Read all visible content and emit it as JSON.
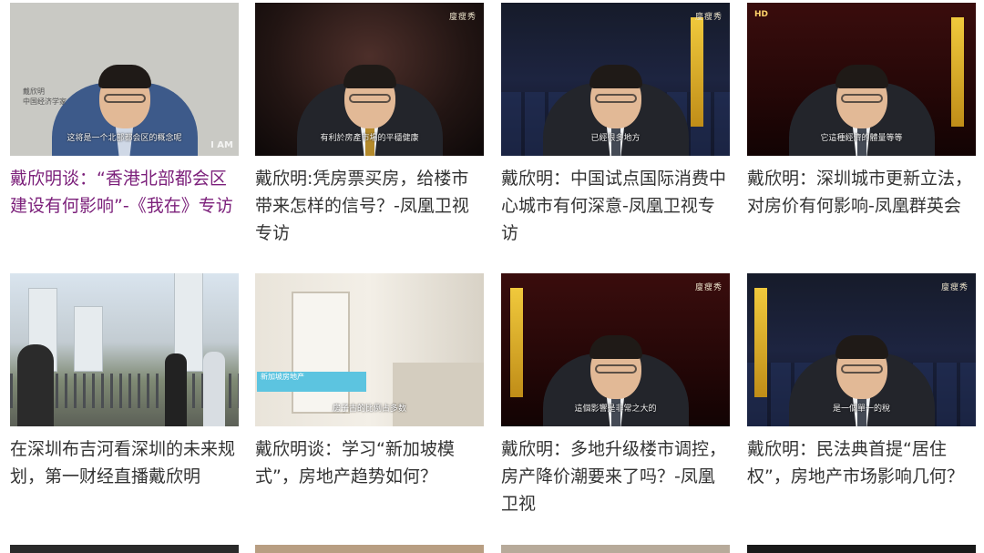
{
  "videos": [
    {
      "title": "戴欣明谈：“香港北部都会区建设有何影响”-《我在》专访",
      "thumb_caption": "这将是一个北部都会区的概念呢",
      "thumb_name": "戴欣明",
      "thumb_name_sub": "中国经济学家",
      "corner": "I AM"
    },
    {
      "title": "戴欣明:凭房票买房，给楼市带来怎样的信号？-凤凰卫视专访",
      "thumb_caption": "有利於房產市場的平穩健康",
      "logo": "廋瘦秀"
    },
    {
      "title": "戴欣明：中国试点国际消费中心城市有何深意-凤凰卫视专访",
      "thumb_caption": "已經很多地方",
      "logo": "廋瘦秀"
    },
    {
      "title": "戴欣明：深圳城市更新立法，对房价有何影响-凤凰群英会",
      "thumb_caption": "它這種經濟的體量等等",
      "logo_left": "HD"
    },
    {
      "title": "在深圳布吉河看深圳的未来规划，第一财经直播戴欣明"
    },
    {
      "title": "戴欣明谈：学习“新加坡模式”，房地产趋势如何？",
      "thumb_caption": "房子古的比例占多数",
      "overlay": "新加坡房地产"
    },
    {
      "title": "戴欣明：多地升级楼市调控，房产降价潮要来了吗？-凤凰卫视",
      "thumb_caption": "這個影響是非常之大的",
      "logo": "廋瘦秀"
    },
    {
      "title": "戴欣明：民法典首提“居住权”，房地产市场影响几何？",
      "thumb_caption": "是一個單一的稅",
      "logo": "廋瘦秀"
    }
  ],
  "colors": {
    "title_text": "#333333",
    "visited_title": "#7b1f7a"
  }
}
